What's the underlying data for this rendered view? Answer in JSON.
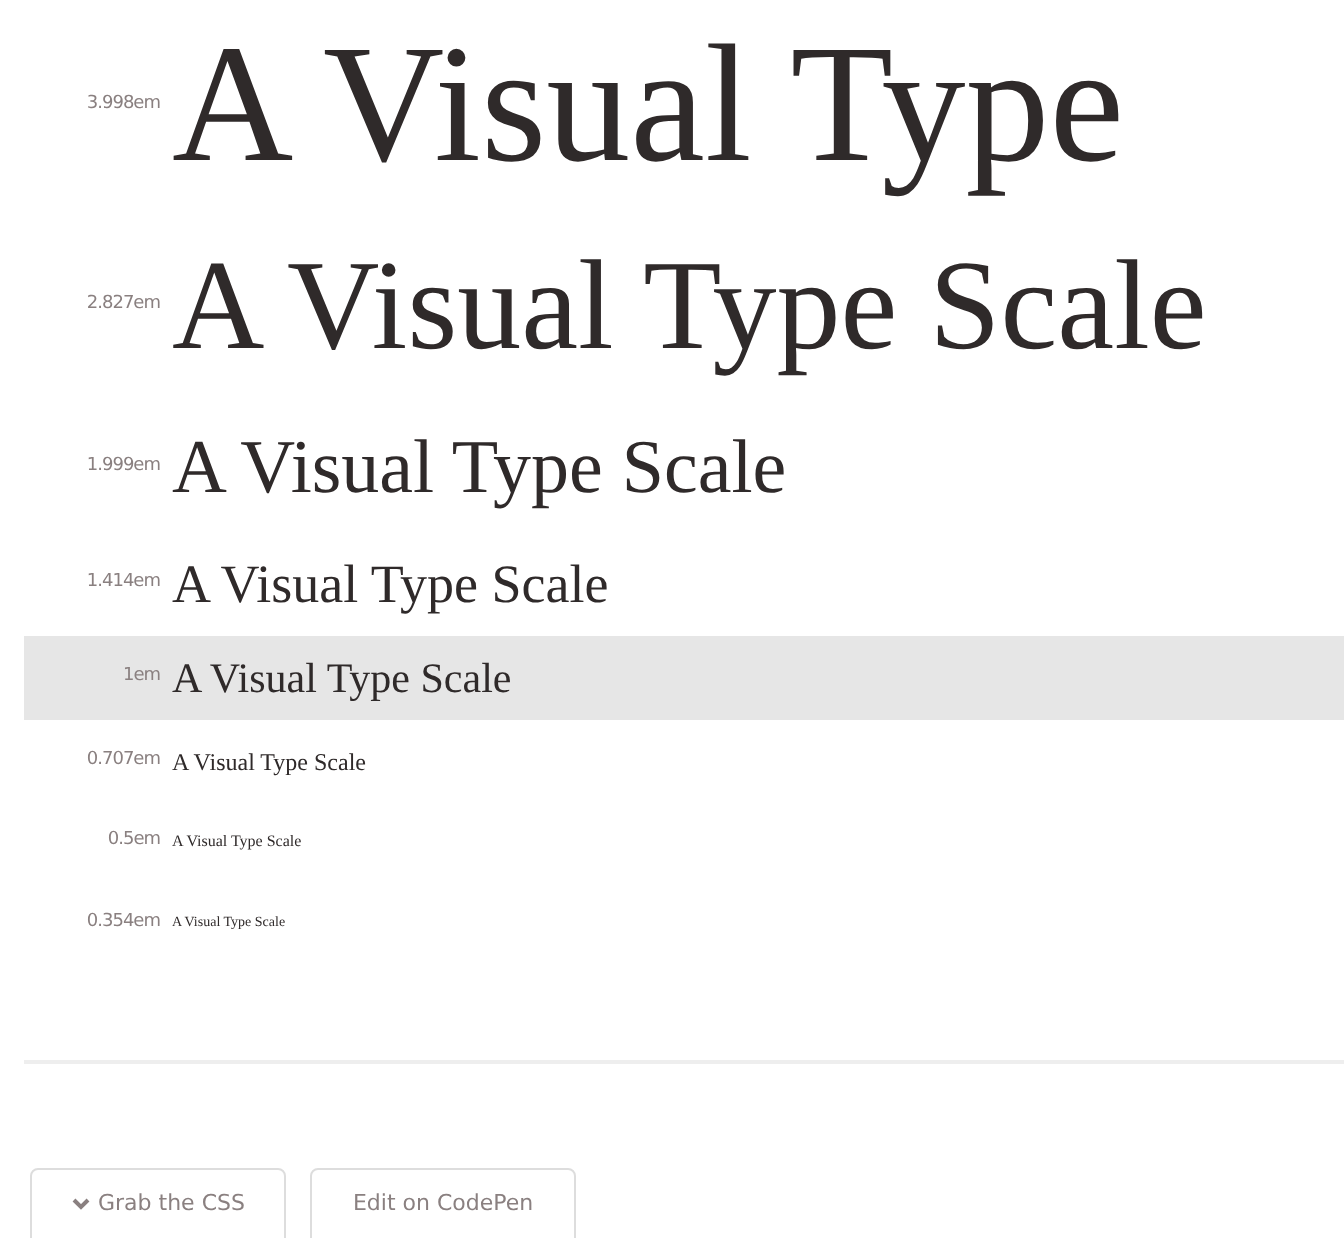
{
  "scale": [
    {
      "label": "3.998em",
      "sample": "A Visual Type",
      "selected": false
    },
    {
      "label": "2.827em",
      "sample": "A Visual Type Scale",
      "selected": false
    },
    {
      "label": "1.999em",
      "sample": "A Visual Type Scale",
      "selected": false
    },
    {
      "label": "1.414em",
      "sample": "A Visual Type Scale",
      "selected": false
    },
    {
      "label": "1em",
      "sample": "A Visual Type Scale",
      "selected": true
    },
    {
      "label": "0.707em",
      "sample": "A Visual Type Scale",
      "selected": false
    },
    {
      "label": "0.5em",
      "sample": "A Visual Type Scale",
      "selected": false
    },
    {
      "label": "0.354em",
      "sample": "A Visual Type Scale",
      "selected": false
    }
  ],
  "buttons": [
    {
      "label": "Grab the CSS",
      "kind": "dropdown"
    },
    {
      "label": "Edit on CodePen",
      "kind": "plain"
    }
  ]
}
